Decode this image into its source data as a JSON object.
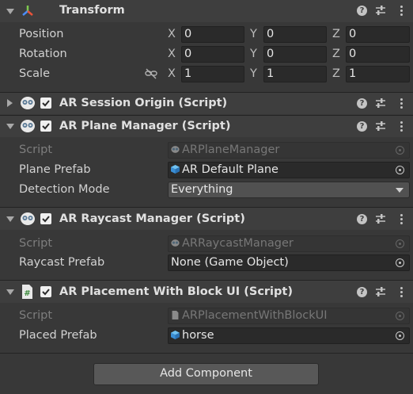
{
  "transform": {
    "title": "Transform",
    "rows": [
      {
        "label": "Position",
        "x": "0",
        "y": "0",
        "z": "0"
      },
      {
        "label": "Rotation",
        "x": "0",
        "y": "0",
        "z": "0"
      },
      {
        "label": "Scale",
        "x": "1",
        "y": "1",
        "z": "1"
      }
    ],
    "axes": {
      "x": "X",
      "y": "Y",
      "z": "Z"
    }
  },
  "components": [
    {
      "title": "AR Session Origin (Script)"
    },
    {
      "title": "AR Plane Manager (Script)",
      "script_label": "Script",
      "script_value": "ARPlaneManager",
      "prefab_label": "Plane Prefab",
      "prefab_value": "AR Default Plane",
      "mode_label": "Detection Mode",
      "mode_value": "Everything"
    },
    {
      "title": "AR Raycast Manager (Script)",
      "script_label": "Script",
      "script_value": "ARRaycastManager",
      "prefab_label": "Raycast Prefab",
      "prefab_value": "None (Game Object)"
    },
    {
      "title": "AR Placement With Block UI (Script)",
      "script_label": "Script",
      "script_value": "ARPlacementWithBlockUI",
      "prefab_label": "Placed Prefab",
      "prefab_value": "horse"
    }
  ],
  "add_component_label": "Add Component",
  "header_icons": {
    "help": "?"
  }
}
